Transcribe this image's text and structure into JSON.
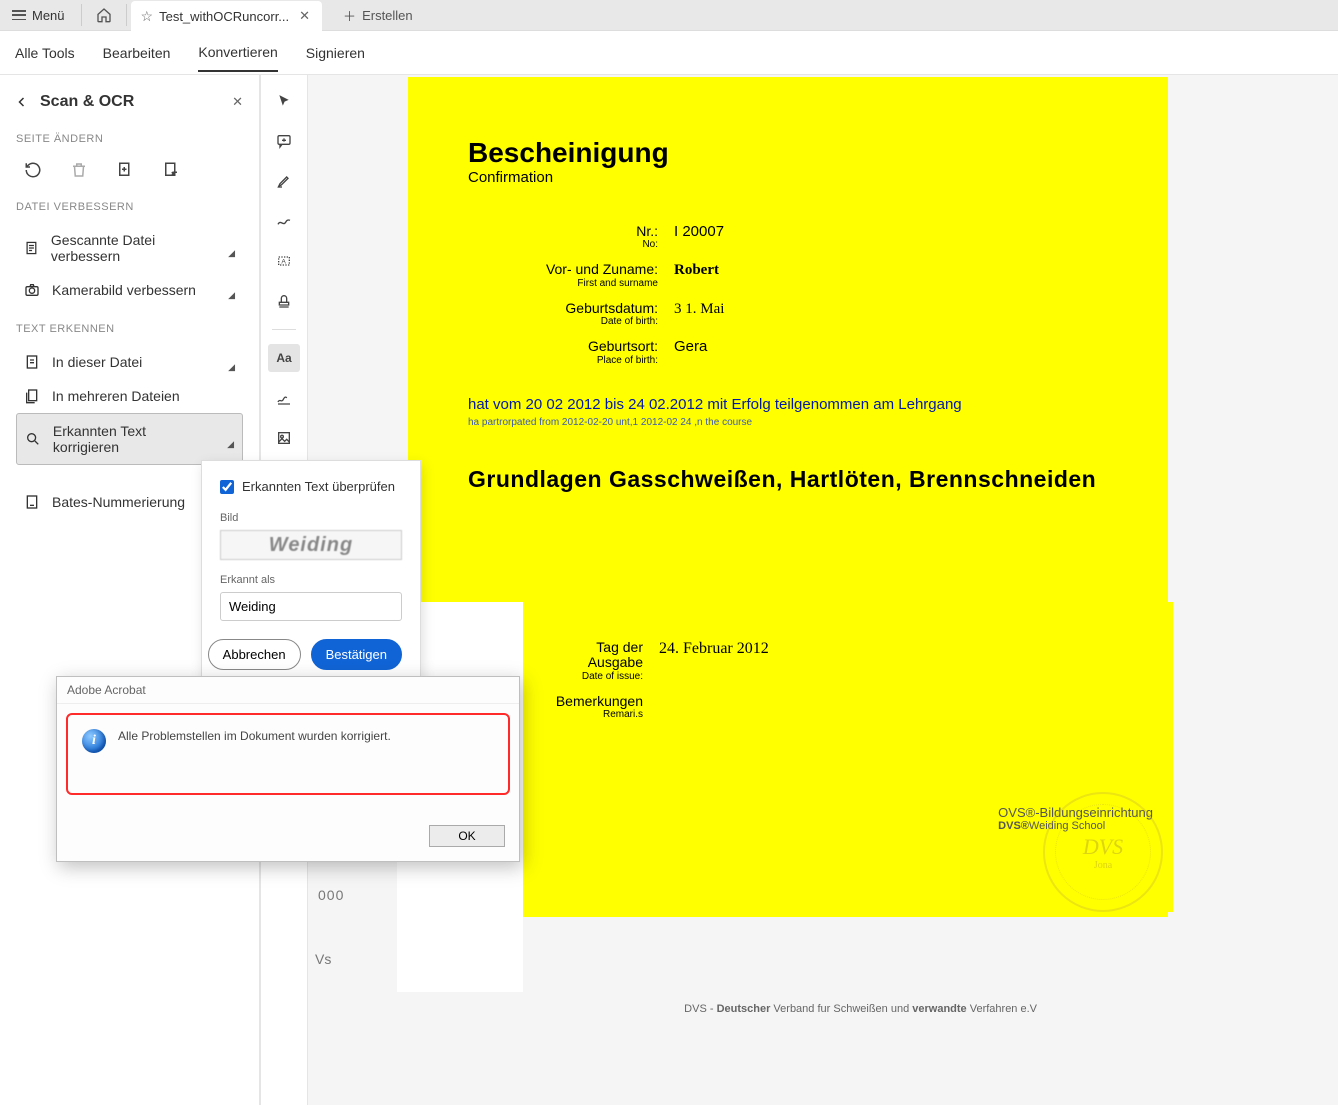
{
  "titlebar": {
    "menu_label": "Menü",
    "tab_title": "Test_withOCRuncorr...",
    "new_tab": "Erstellen"
  },
  "toolbar": {
    "items": [
      "Alle Tools",
      "Bearbeiten",
      "Konvertieren",
      "Signieren"
    ],
    "active_index": 2
  },
  "left_panel": {
    "title": "Scan & OCR",
    "section_change": "SEITE ÄNDERN",
    "section_improve": "DATEI VERBESSERN",
    "improve_items": [
      "Gescannte Datei verbessern",
      "Kamerabild verbessern"
    ],
    "section_recognize": "TEXT ERKENNEN",
    "recognize_items": [
      "In dieser Datei",
      "In mehreren Dateien",
      "Erkannten Text korrigieren"
    ],
    "selected_index": 2,
    "bates": "Bates-Nummerierung"
  },
  "popover": {
    "checkbox_label": "Erkannten Text überprüfen",
    "checked": true,
    "image_label": "Bild",
    "image_text": "Weiding",
    "recognized_label": "Erkannt als",
    "recognized_value": "Weiding",
    "cancel": "Abbrechen",
    "confirm": "Bestätigen"
  },
  "dialog": {
    "app_name": "Adobe Acrobat",
    "message": "Alle Problemstellen im Dokument wurden korrigiert.",
    "ok": "OK"
  },
  "document": {
    "h1": "Bescheinigung",
    "sub": "Confirmation",
    "nr_label": "Nr.:",
    "nr_en": "No:",
    "nr_value": "I 20007",
    "name_label": "Vor- und Zuname:",
    "name_en": "First and surname",
    "name_value": "Robert",
    "birth_label": "Geburtsdatum:",
    "birth_en": "Date of birth:",
    "birth_value": "3 1. Mai",
    "place_label": "Geburtsort:",
    "place_en": "Place of birth:",
    "place_value": "Gera",
    "para_de": "hat vom 20 02 2012 bis 24 02.2012 mit Erfolg teilgenommen am Lehrgang",
    "para_en": "ha   partrorpated from 2012-02-20 unt,1 2012-02  24  ,n the course",
    "course": "Grundlagen Gasschweißen, Hartlöten, Brennschneiden",
    "issue_label": "Tag der Ausgabe",
    "issue_en": "Date of issue:",
    "issue_value": "24. Februar 2012",
    "remarks_label": "Bemerkungen",
    "remarks_en": "Remari.s",
    "inst1": "OVS®-Bildungseinrichtung",
    "inst2_a": "DVS®",
    "inst2_b": "Weiding School",
    "stamp_text": "DVS",
    "stamp_sub": "Jona",
    "footer": {
      "pre": "DVS - ",
      "b1": "Deutscher",
      "mid1": " Verband fur Schweißen und ",
      "b2": "verwandte",
      "mid2": " Verfahren e.V"
    },
    "corner1": "000",
    "corner2": "Vs"
  }
}
